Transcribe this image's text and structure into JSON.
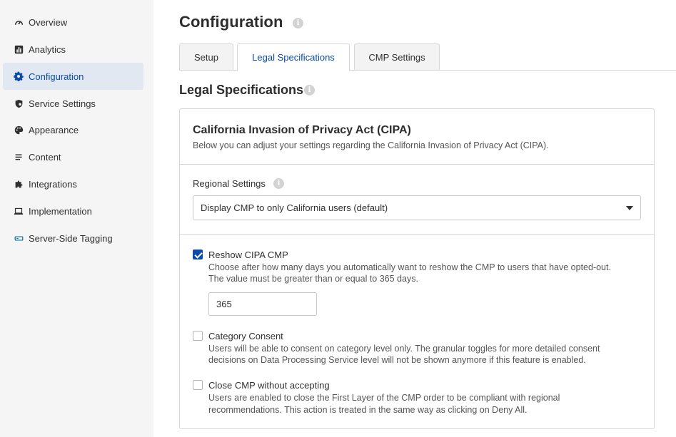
{
  "sidebar": {
    "items": [
      {
        "label": "Overview",
        "icon": "gauge-icon",
        "active": false
      },
      {
        "label": "Analytics",
        "icon": "bar-chart-icon",
        "active": false
      },
      {
        "label": "Configuration",
        "icon": "gear-icon",
        "active": true
      },
      {
        "label": "Service Settings",
        "icon": "shield-icon",
        "active": false
      },
      {
        "label": "Appearance",
        "icon": "palette-icon",
        "active": false
      },
      {
        "label": "Content",
        "icon": "list-icon",
        "active": false
      },
      {
        "label": "Integrations",
        "icon": "puzzle-icon",
        "active": false
      },
      {
        "label": "Implementation",
        "icon": "laptop-code-icon",
        "active": false
      },
      {
        "label": "Server-Side Tagging",
        "icon": "server-icon",
        "active": false
      }
    ]
  },
  "header": {
    "title": "Configuration",
    "info": "i"
  },
  "tabs": [
    {
      "label": "Setup",
      "active": false
    },
    {
      "label": "Legal Specifications",
      "active": true
    },
    {
      "label": "CMP Settings",
      "active": false
    }
  ],
  "section": {
    "title": "Legal Specifications",
    "info": "i"
  },
  "card": {
    "title": "California Invasion of Privacy Act (CIPA)",
    "description": "Below you can adjust your settings regarding the California Invasion of Privacy Act (CIPA).",
    "regional_label": "Regional Settings",
    "regional_info": "i",
    "regional_value": "Display CMP to only California users (default)",
    "reshow": {
      "title": "Reshow CIPA CMP",
      "checked": true,
      "desc_line1": "Choose after how many days you automatically want to reshow the CMP to users that have opted-out.",
      "desc_line2": "The value must be greater than or equal to 365 days.",
      "days_value": "365"
    },
    "category_consent": {
      "title": "Category Consent",
      "checked": false,
      "desc_line1": "Users will be able to consent on category level only. The granular toggles for more detailed consent",
      "desc_line2": "decisions on Data Processing Service level will not be shown anymore if this feature is enabled."
    },
    "close_cmp": {
      "title": "Close CMP without accepting",
      "checked": false,
      "desc_line1": "Users are enabled to close the First Layer of the CMP order to be compliant with regional",
      "desc_line2": "recommendations. This action is treated in the same way as clicking on Deny All."
    }
  },
  "colors": {
    "accent": "#0a4aa8",
    "sidebar_bg": "#f5f5f5",
    "active_bg": "#e1e8f1"
  }
}
